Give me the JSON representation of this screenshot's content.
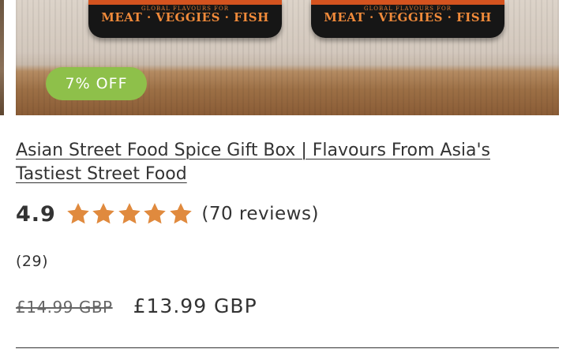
{
  "product": {
    "image": {
      "packaging_text_small": "GLOBAL FLAVOURS FOR",
      "packaging_text_main": "MEAT · VEGGIES · FISH"
    },
    "discount_badge": "7% OFF",
    "title": "Asian Street Food Spice Gift Box | Flavours From Asia's Tastiest Street Food",
    "rating": {
      "value": "4.9",
      "stars_filled": 5,
      "stars_total": 5,
      "reviews_label": "(70 reviews)",
      "star_icon": "star-icon",
      "star_color": "#e08a3e"
    },
    "secondary_count": "(29)",
    "price": {
      "original": "£14.99 GBP",
      "sale": "£13.99 GBP"
    }
  },
  "colors": {
    "badge_bg": "#8ec04a",
    "star": "#e08a3e",
    "text": "#333333"
  }
}
